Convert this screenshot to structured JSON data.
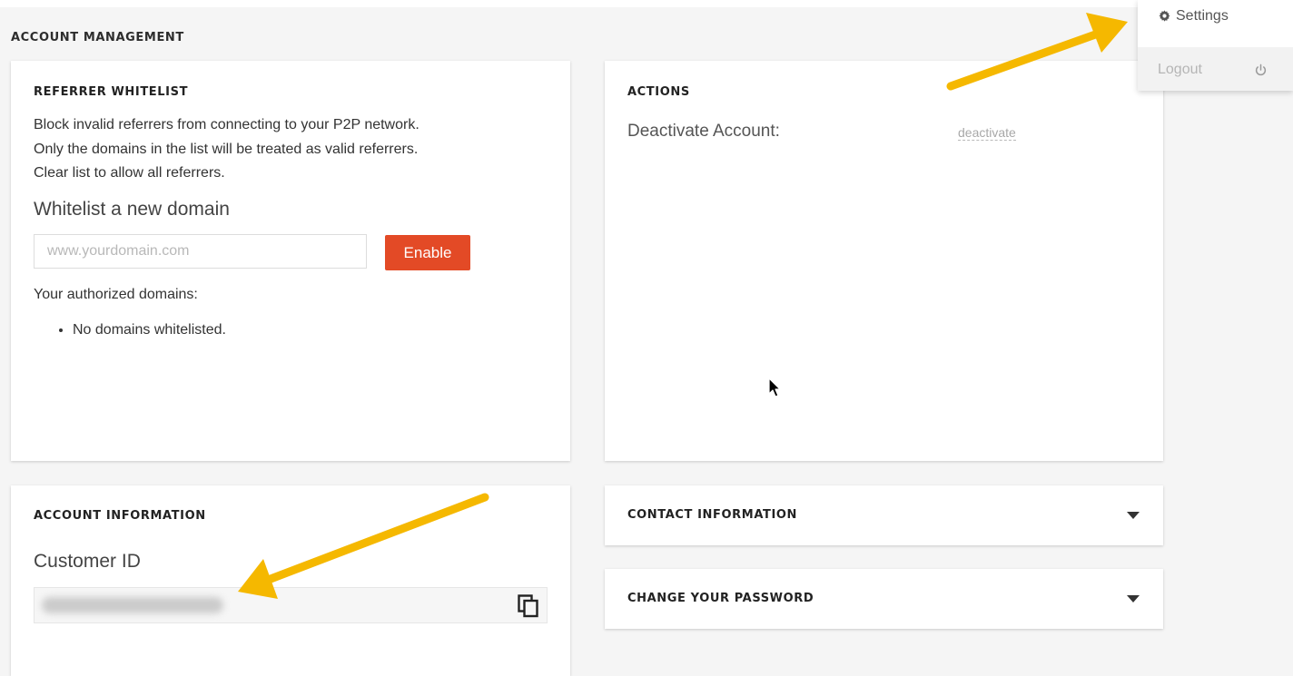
{
  "page": {
    "heading": "ACCOUNT MANAGEMENT"
  },
  "referrer_whitelist": {
    "title": "REFERRER WHITELIST",
    "description": [
      "Block invalid referrers from connecting to your P2P network.",
      "Only the domains in the list will be treated as valid referrers.",
      "Clear list to allow all referrers."
    ],
    "subheading": "Whitelist a new domain",
    "input_placeholder": "www.yourdomain.com",
    "input_value": "",
    "enable_label": "Enable",
    "authorized_label": "Your authorized domains:",
    "domains_empty": "No domains whitelisted."
  },
  "actions": {
    "title": "ACTIONS",
    "deactivate_label": "Deactivate Account:",
    "deactivate_link": "deactivate"
  },
  "account_info": {
    "title": "ACCOUNT INFORMATION",
    "customer_id_label": "Customer ID",
    "copy_icon": "copy-icon"
  },
  "contact_info": {
    "title": "CONTACT INFORMATION",
    "icon": "caret-down-icon"
  },
  "change_password": {
    "title": "CHANGE YOUR PASSWORD",
    "icon": "caret-down-icon"
  },
  "user_menu": {
    "settings_label": "Settings",
    "settings_icon": "gear-icon",
    "logout_label": "Logout",
    "logout_icon": "power-icon"
  },
  "colors": {
    "accent": "#e34a26",
    "annotation_arrow": "#f5b800",
    "background": "#f5f5f5"
  }
}
